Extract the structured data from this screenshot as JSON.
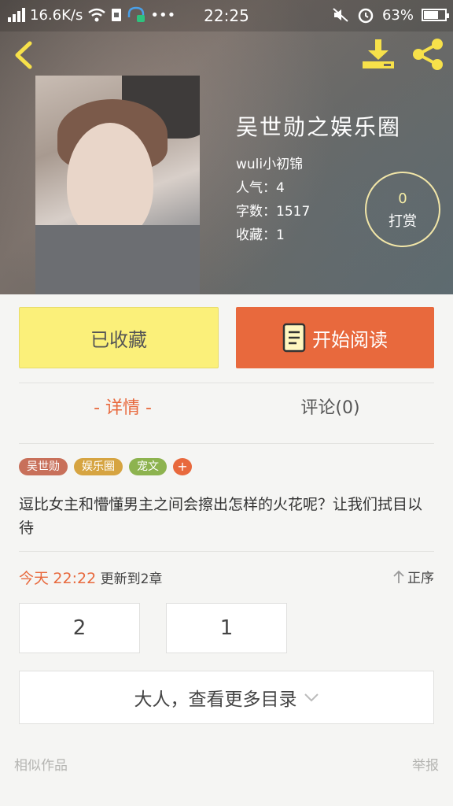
{
  "status_bar": {
    "speed": "16.6K/s",
    "time": "22:25",
    "battery": "63%",
    "battery_level": 0.63
  },
  "book": {
    "title": "吴世勋之娱乐圈",
    "author": "wuli小初锦",
    "popularity": "人气：4",
    "word_count": "字数：1517",
    "favorites": "收藏：1"
  },
  "reward": {
    "count": "0",
    "label": "打赏"
  },
  "actions": {
    "collected_label": "已收藏",
    "read_label": "开始阅读"
  },
  "tabs": {
    "detail": "- 详情 -",
    "comments": "评论(0)"
  },
  "tags": [
    {
      "label": "吴世勋",
      "color": "#c8705a"
    },
    {
      "label": "娱乐圈",
      "color": "#d6a441"
    },
    {
      "label": "宠文",
      "color": "#8db34f"
    }
  ],
  "tag_add": "+",
  "description": "逗比女主和懵懂男主之间会擦出怎样的火花呢？让我们拭目以待",
  "update": {
    "day": "今天",
    "time": "22:22",
    "text": "更新到2章"
  },
  "sort_label": "正序",
  "chapters": [
    "2",
    "1"
  ],
  "more_directory": "大人，查看更多目录",
  "footer": {
    "similar": "相似作品",
    "report": "举报"
  },
  "colors": {
    "accent": "#e8693d",
    "collected_bg": "#fbf07a",
    "icon_yellow": "#f7e14a"
  }
}
